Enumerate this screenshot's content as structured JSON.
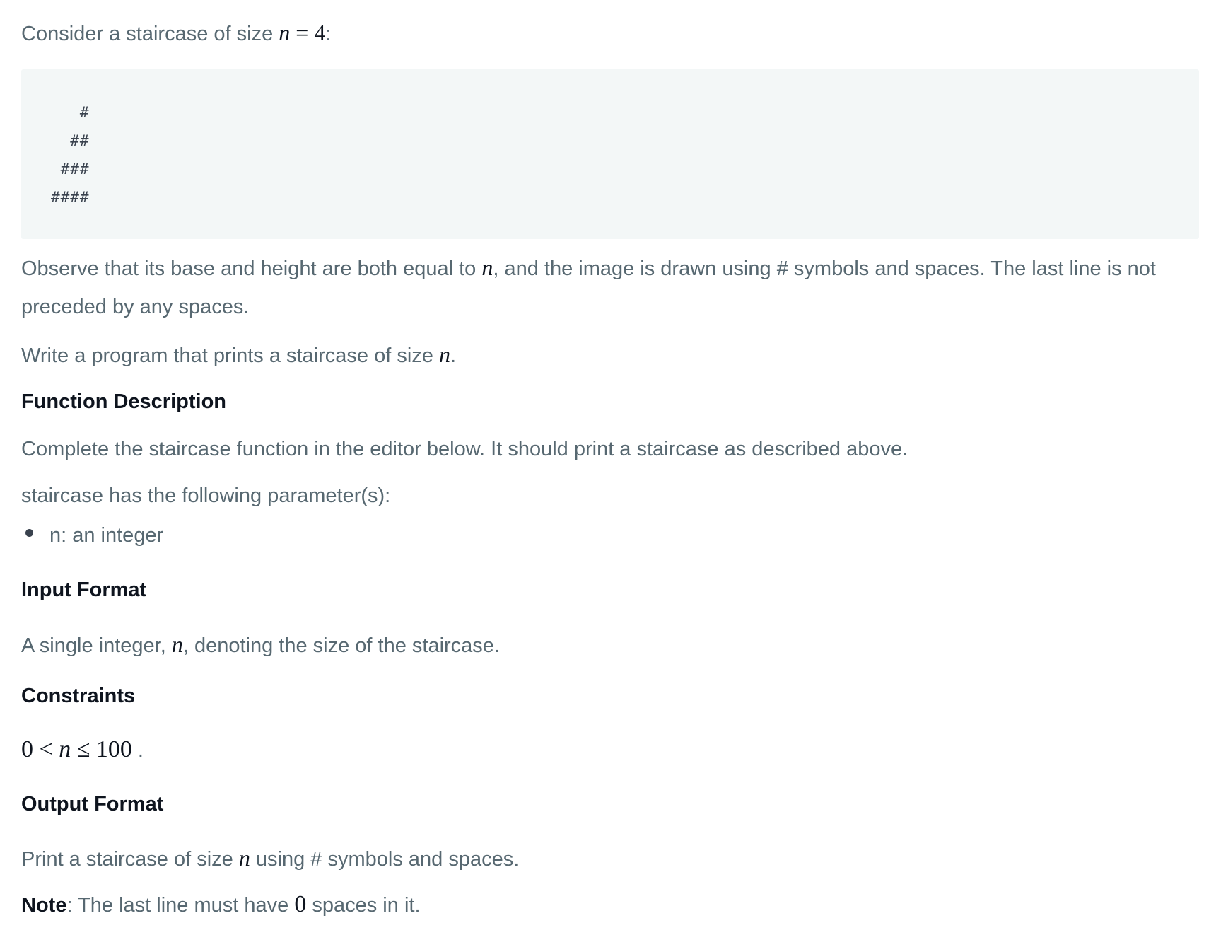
{
  "intro": {
    "text": "Consider a staircase of size ",
    "var": "n",
    "eq": " = 4",
    "colon": ":"
  },
  "code_lines": [
    "   #",
    "  ##",
    " ###",
    "####"
  ],
  "observe": {
    "line1_a": "Observe that its base and height are both equal to ",
    "var": "n",
    "line1_b": ", and the image is drawn using # symbols and spaces. The last line is not",
    "line2": "preceded by any spaces."
  },
  "write": {
    "text": "Write a program that prints a staircase of size ",
    "var": "n",
    "end": "."
  },
  "function_description": {
    "heading": "Function Description",
    "text": "Complete the staircase function in the editor below. It should print a staircase as described above.",
    "params_intro": "staircase has the following parameter(s):",
    "params": [
      "n: an integer"
    ]
  },
  "input_format": {
    "heading": "Input Format",
    "text_a": "A single integer, ",
    "var": "n",
    "text_b": ", denoting the size of the staircase."
  },
  "constraints": {
    "heading": "Constraints",
    "expr_a": "0 < ",
    "var": "n",
    "expr_b": " ≤ 100",
    "end": " ."
  },
  "output_format": {
    "heading": "Output Format",
    "text_a": "Print a staircase of size ",
    "var": "n",
    "text_b": " using # symbols and spaces.",
    "note_label": "Note",
    "note_a": ": The last line must have ",
    "note_num": "0",
    "note_b": " spaces in it."
  }
}
